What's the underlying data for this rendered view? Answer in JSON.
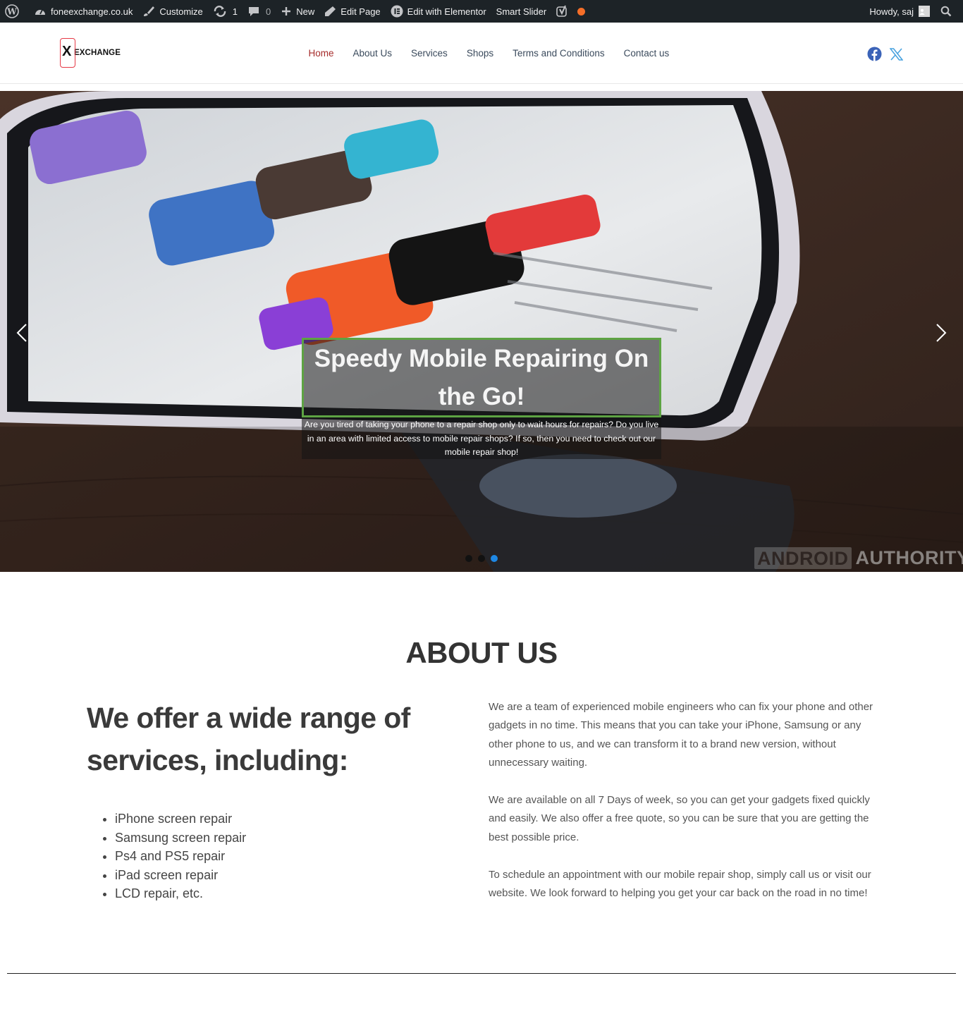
{
  "admin_bar": {
    "site": "foneexchange.co.uk",
    "customize": "Customize",
    "updates": "1",
    "comments": "0",
    "new": "New",
    "edit_page": "Edit Page",
    "edit_elementor": "Edit with Elementor",
    "smart_slider": "Smart Slider",
    "howdy": "Howdy, saj"
  },
  "header": {
    "logo_text": "EXCHANGE",
    "nav": [
      {
        "label": "Home",
        "active": true
      },
      {
        "label": "About Us"
      },
      {
        "label": "Services"
      },
      {
        "label": "Shops"
      },
      {
        "label": "Terms and Conditions"
      },
      {
        "label": "Contact us"
      }
    ],
    "social": [
      "facebook-icon",
      "x-twitter-icon"
    ]
  },
  "slider": {
    "title": "Speedy Mobile Repairing On the Go!",
    "description": "Are you tired of taking your phone to a repair shop only to wait hours for repairs? Do you live in an area with limited access to mobile repair shops? If so, then you need to check out our mobile repair shop!",
    "active_slide": 3,
    "slide_count": 3,
    "watermark_box": "ANDROID",
    "watermark_text": "AUTHORITY"
  },
  "about": {
    "title": "ABOUT US",
    "heading": "We offer a wide range of services, including:",
    "services": [
      "iPhone screen repair",
      "Samsung screen repair",
      "Ps4 and PS5 repair",
      "iPad screen repair",
      "LCD repair, etc."
    ],
    "paragraphs": [
      "We are a team of experienced mobile engineers who can fix your phone and other gadgets in no time. This means that you can take your iPhone, Samsung or any other phone to us, and we can transform it to a brand new version, without unnecessary waiting.",
      "We are available on all 7 Days of week, so you can get your gadgets fixed quickly and easily. We also offer a free quote, so you can be sure that you are getting the best possible price.",
      "To schedule an appointment with our mobile repair shop, simply call us or visit our website. We look forward to helping you get your car back on the road in no time!"
    ]
  },
  "colors": {
    "admin_bar": "#1d2327",
    "nav_active": "#a62c2b",
    "caption_border": "#5da343",
    "active_dot": "#1e88e5"
  }
}
